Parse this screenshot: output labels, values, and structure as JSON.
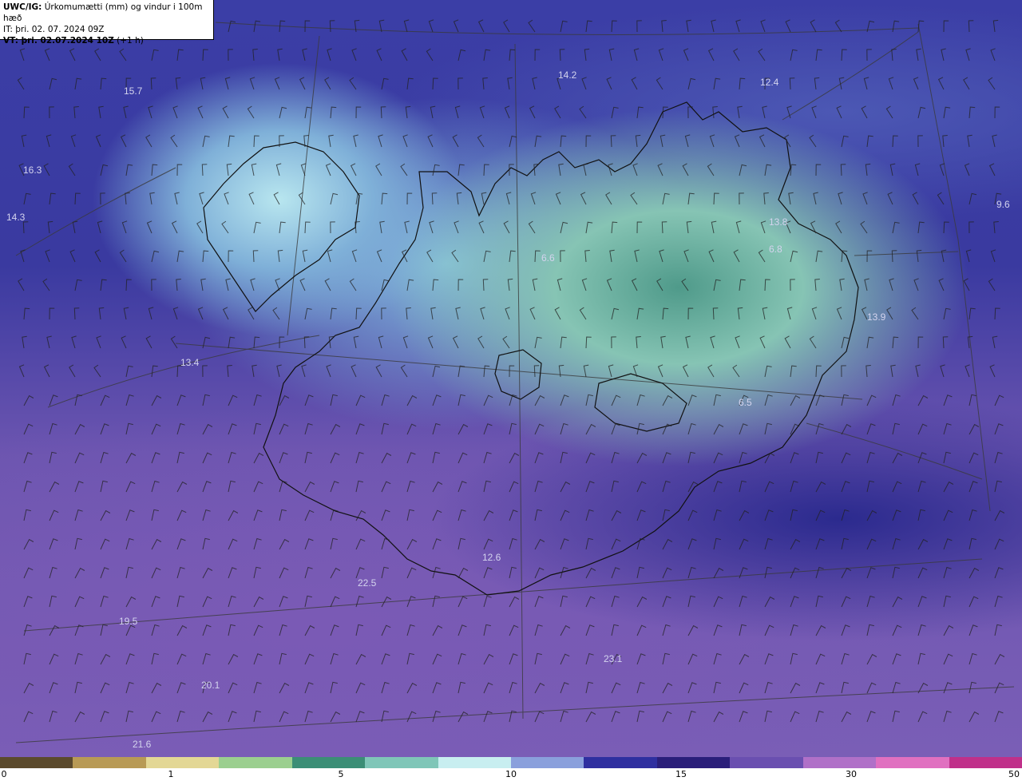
{
  "title": {
    "line1_bold": "UWC/IG:",
    "line1_rest": " Úrkomumætti (mm) og vindur i 100m hæð",
    "line2": "IT: þri. 02. 07. 2024 09Z",
    "line3_bold": "VT: þri. 02.07.2024 10Z",
    "line3_rest": " (+1 h)"
  },
  "values": [
    {
      "text": "15.7"
    },
    {
      "text": "14.2"
    },
    {
      "text": "12.4"
    },
    {
      "text": "16.3"
    },
    {
      "text": "14.3"
    },
    {
      "text": "13.8"
    },
    {
      "text": "6.8"
    },
    {
      "text": "6.6"
    },
    {
      "text": "13.9"
    },
    {
      "text": "13.4"
    },
    {
      "text": "6.5"
    },
    {
      "text": "9.6"
    },
    {
      "text": "12.6"
    },
    {
      "text": "22.5"
    },
    {
      "text": "19.5"
    },
    {
      "text": "23.1"
    },
    {
      "text": "20.1"
    },
    {
      "text": "21.6"
    }
  ],
  "colorbar": {
    "labels": [
      "0",
      "1",
      "5",
      "10",
      "15",
      "30",
      "50"
    ],
    "colors": [
      "#5b4a2c",
      "#b89a55",
      "#e3d795",
      "#9bcf8f",
      "#3b8e76",
      "#7fc6b8",
      "#c8eef0",
      "#8aa0dc",
      "#2f2fa0",
      "#2a1e7a",
      "#6a4fb0",
      "#b070c8",
      "#e070c0",
      "#c0308a"
    ]
  },
  "colors": {
    "coast": "#111111",
    "grid": "#3a3a3a",
    "value_text": "#d4d4ee"
  }
}
